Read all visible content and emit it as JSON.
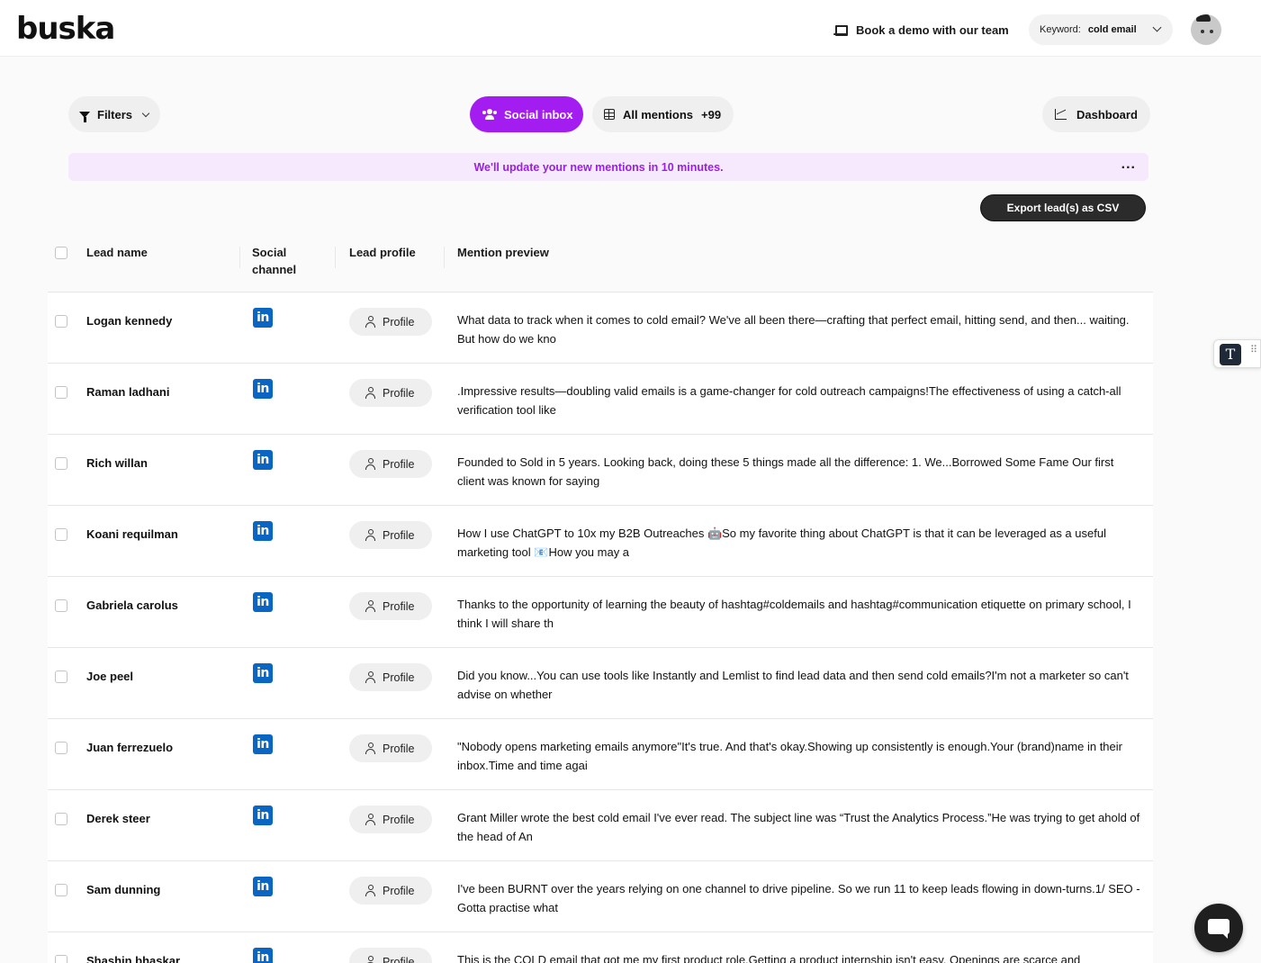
{
  "app": {
    "logo_text": "buska",
    "book_demo_label": "Book a demo with our team",
    "keyword_label": "Keyword:",
    "keyword_value": "cold email"
  },
  "toolbar": {
    "filters_label": "Filters",
    "social_inbox_label": "Social inbox",
    "all_mentions_label": "All mentions",
    "all_mentions_count": "+99",
    "dashboard_label": "Dashboard"
  },
  "banner": {
    "text": "We'll update your new mentions in 10 minutes.",
    "more": "..."
  },
  "export_label": "Export lead(s) as CSV",
  "table": {
    "headers": {
      "lead_name": "Lead name",
      "social_channel": "Social channel",
      "lead_profile": "Lead profile",
      "mention_preview": "Mention preview"
    },
    "profile_label": "Profile",
    "channel_icon": "linkedin-icon",
    "rows": [
      {
        "name": "Logan kennedy",
        "preview": "What data to track when it comes to cold email? We've all been there—crafting that perfect email, hitting send, and then... waiting. But how do we kno"
      },
      {
        "name": "Raman ladhani",
        "preview": ".Impressive results—doubling valid emails is a game-changer for cold outreach campaigns!The effectiveness of using a catch-all verification tool like"
      },
      {
        "name": "Rich willan",
        "preview": "Founded to Sold in 5 years. Looking back, doing these 5 things made all the difference: 1. We...Borrowed Some Fame Our first client was known for saying"
      },
      {
        "name": "Koani requilman",
        "preview": "How I use ChatGPT to 10x my B2B Outreaches 🤖So my favorite thing about ChatGPT is that it can be leveraged as a useful marketing tool 📧How you may a"
      },
      {
        "name": "Gabriela carolus",
        "preview": "Thanks to the opportunity of learning the beauty of hashtag#coldemails and hashtag#communication etiquette on primary school, I think I will share th"
      },
      {
        "name": "Joe peel",
        "preview": "Did you know...You can use tools like Instantly and Lemlist to find lead data and then send cold emails?I'm not a marketer so can't advise on whether"
      },
      {
        "name": "Juan ferrezuelo",
        "preview": "\"Nobody opens marketing emails anymore\"It's true. And that's okay.Showing up consistently is enough.Your (brand)name in their inbox.Time and time agai"
      },
      {
        "name": "Derek steer",
        "preview": "Grant Miller wrote the best cold email I've ever read. The subject line was “Trust the Analytics Process.”He was trying to get ahold of the head of An"
      },
      {
        "name": "Sam dunning",
        "preview": "I've been BURNT over the years relying on one channel to drive pipeline. So we run 11 to keep leads flowing in down-turns.1/ SEO - Gotta practise what"
      },
      {
        "name": "Shashin bhaskar",
        "preview": "This is the COLD email that got me my first product role.Getting a product internship isn't easy. Openings are scarce and"
      }
    ]
  },
  "widgets": {
    "text_tool_glyph": "T",
    "grip_glyph": "⠿"
  },
  "colors": {
    "accent": "#a31cf0",
    "banner_bg": "#f6e9fd",
    "banner_text": "#9b1ee4",
    "linkedin": "#0a66c2",
    "export_bg": "#2b2b2b"
  }
}
